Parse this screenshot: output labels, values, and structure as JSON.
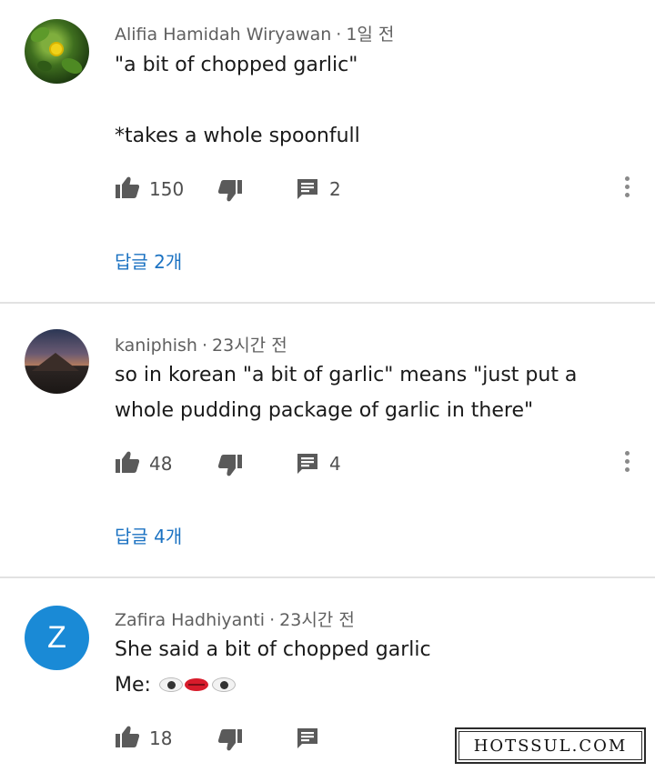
{
  "comments": [
    {
      "author": "Alifia Hamidah Wiryawan",
      "time": "1일 전",
      "lines": [
        "\"a bit of chopped garlic\"",
        "",
        "*takes a whole spoonfull"
      ],
      "likes": "150",
      "reply_count": "2",
      "replies_link": "답글 2개",
      "avatar": "garden-photo"
    },
    {
      "author": "kaniphish",
      "time": "23시간 전",
      "lines": [
        "so in korean \"a bit of garlic\" means \"just put a",
        "whole pudding package of garlic in there\""
      ],
      "likes": "48",
      "reply_count": "4",
      "replies_link": "답글 4개",
      "avatar": "mountain-photo"
    },
    {
      "author": "Zafira Hadhiyanti",
      "time": "23시간 전",
      "lines": [
        "She said a bit of chopped garlic",
        "Me: "
      ],
      "likes": "18",
      "reply_count": "",
      "avatar_letter": "Z",
      "avatar_color": "#1a8ad6"
    }
  ],
  "separator": "·",
  "watermark": "HOTSSUL.COM",
  "icons": {
    "like": "thumbs-up-icon",
    "dislike": "thumbs-down-icon",
    "reply": "comment-icon",
    "more": "more-vertical-icon"
  },
  "colors": {
    "link": "#1b72c2",
    "meta": "#5f5f5f",
    "icon": "#5a5a5a",
    "divider": "#e2e2e2"
  }
}
